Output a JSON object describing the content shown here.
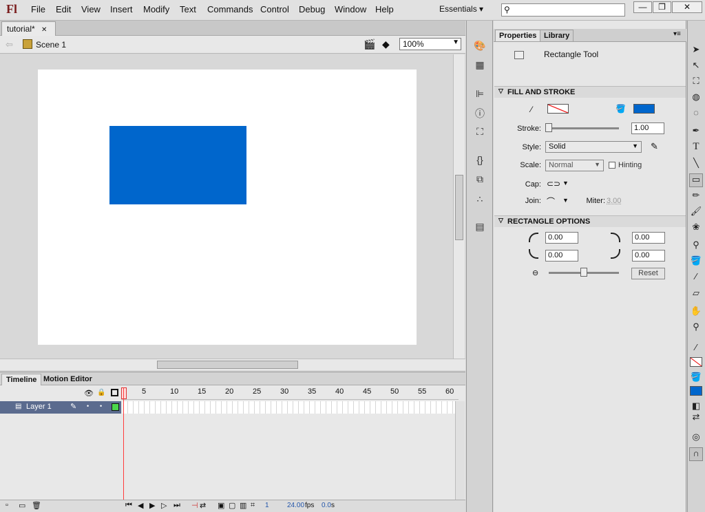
{
  "app": {
    "logo": "Fl",
    "workspace": "Essentials",
    "workspace_arrow": "▾"
  },
  "menu": [
    "File",
    "Edit",
    "View",
    "Insert",
    "Modify",
    "Text",
    "Commands",
    "Control",
    "Debug",
    "Window",
    "Help"
  ],
  "window_buttons": {
    "minimize": "—",
    "restore": "❐",
    "close": "✕"
  },
  "document": {
    "tab": "tutorial*",
    "tab_close": "✕",
    "scene": "Scene 1",
    "zoom": "100%"
  },
  "timeline": {
    "tabs": [
      "Timeline",
      "Motion Editor"
    ],
    "layer": "Layer 1",
    "frame_numbers": [
      "5",
      "10",
      "15",
      "20",
      "25",
      "30",
      "35",
      "40",
      "45",
      "50",
      "55",
      "60"
    ],
    "current_frame": "1",
    "fps": "24.00",
    "fps_label": "fps",
    "time": "0.0",
    "time_unit": "s"
  },
  "properties": {
    "tabs": [
      "Properties",
      "Library"
    ],
    "tool": "Rectangle Tool",
    "fill_stroke_title": "FILL AND STROKE",
    "stroke_label": "Stroke:",
    "stroke_value": "1.00",
    "style_label": "Style:",
    "style_value": "Solid",
    "scale_label": "Scale:",
    "scale_value": "Normal",
    "hinting": "Hinting",
    "cap_label": "Cap:",
    "join_label": "Join:",
    "miter_label": "Miter:",
    "miter_value": "3.00",
    "rect_title": "RECTANGLE OPTIONS",
    "corners": [
      "0.00",
      "0.00",
      "0.00",
      "0.00"
    ],
    "reset": "Reset",
    "fill_color": "#0066cc"
  },
  "colors": {
    "shape_fill": "#0066cc",
    "stage": "#ffffff",
    "layer_row": "#5b6b8e"
  }
}
